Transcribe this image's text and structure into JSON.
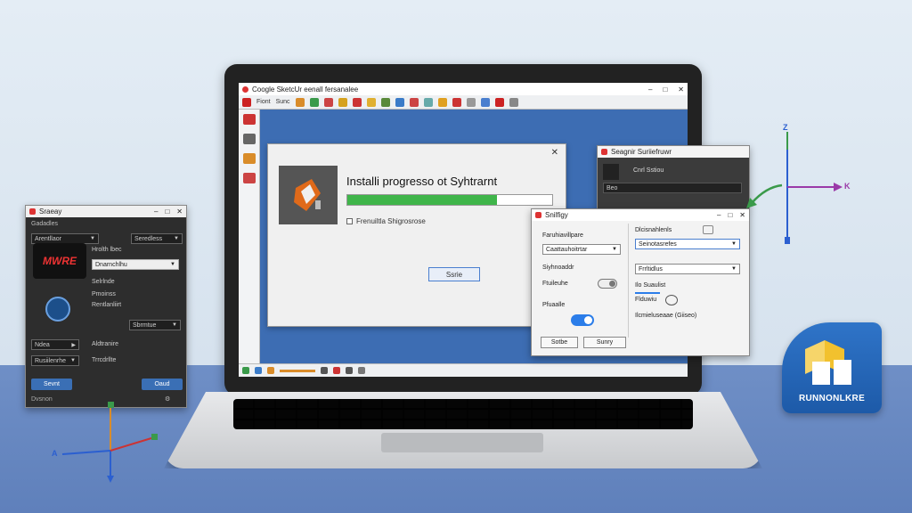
{
  "laptop": {
    "app_title": "Coogle SketcUr eenall fersanalee",
    "win_controls": [
      "–",
      "□",
      "✕"
    ],
    "toolbar_labels": [
      "Fiont",
      "Sunc"
    ],
    "install_dialog": {
      "title": "Installi progresso ot Syhtrarnt",
      "progress": 0.73,
      "progress_color": "#3fb54a",
      "checkbox_label": "Frenuiltla Shigrosrose",
      "save_label": "Ssrie",
      "close": "✕"
    }
  },
  "dark_window": {
    "title": "Sraeay",
    "controls": [
      "–",
      "□",
      "✕"
    ],
    "header_label": "Gadadles",
    "dropdown_1": "Arentllaor",
    "dropdown_2": "Seredless",
    "field_1_label": "Hrolth lbec",
    "field_1_value": "Dnarnchlhu",
    "logo_text": "MWRE",
    "rows": [
      "Selrlnde",
      "Pmoinss",
      "Rentlanliirt",
      "Sbrmtue",
      "Ndea",
      "Aldtranire",
      "Rusiilenrhe",
      "Trrcdrllte"
    ],
    "btn_left": "Sevnt",
    "btn_right": "Oaud",
    "footer_label": "Dvsnon",
    "footer_icon": "⚙"
  },
  "cs_window": {
    "title": "Seagnir Suriiefruwr",
    "subtitle": "Cnrl Sstiou",
    "field": "Beo",
    "controls": [
      "–",
      "□",
      "✕"
    ]
  },
  "settings_window": {
    "title": "Snilfigy",
    "controls": [
      "–",
      "□",
      "✕"
    ],
    "left": {
      "label_1": "Faruhiavillpare",
      "dropdown_1": "Caattauhoitrtar",
      "label_2": "Siyhnoaddr",
      "label_3": "Ftuileuhe",
      "label_4": "Pfuaalle"
    },
    "right": {
      "label_1": "Dlcisnahlenls",
      "dropdown_1": "Seinotasrefes",
      "dropdown_2": "Frrltidlus",
      "label_2": "Ilo Suaulist",
      "label_3": "Flduwiu",
      "label_4": "Ilcmieluseaae (Giiseo)"
    },
    "btn_1": "Sotbe",
    "btn_2": "Sunry"
  },
  "gizmo_left": {
    "x_label": "A",
    "y_label": "",
    "z_label": ""
  },
  "gizmo_right": {
    "z_label": "Z",
    "x_label": "K"
  },
  "tile": {
    "name": "RUNNONLKRE"
  },
  "colors": {
    "desk": "#6f8fc6",
    "screen": "#3d6db3",
    "accent_blue": "#2b7de9",
    "progress_green": "#3fb54a",
    "tile_blue": "#1d5aa8"
  }
}
